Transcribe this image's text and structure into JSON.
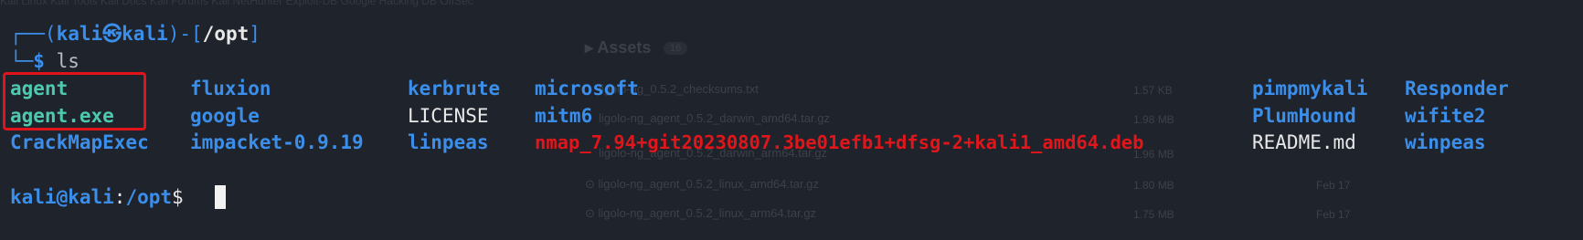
{
  "background": {
    "bookmarks": "Kali Linux   Kali Tools   Kali Docs   Kali Forums   Kali NetHunter   Exploit-DB   Google Hacking DB   OffSec",
    "assets_heading": "Assets",
    "assets_count": "16",
    "files": [
      {
        "name": "ligolo-ng_0.5.2_checksums.txt",
        "size": "1.57 KB"
      },
      {
        "name": "ligolo-ng_agent_0.5.2_darwin_amd64.tar.gz",
        "size": "1.98 MB"
      },
      {
        "name": "ligolo-ng_agent_0.5.2_darwin_arm64.tar.gz",
        "size": "1.96 MB"
      },
      {
        "name": "ligolo-ng_agent_0.5.2_linux_amd64.tar.gz",
        "size": "1.80 MB"
      },
      {
        "name": "ligolo-ng_agent_0.5.2_linux_arm64.tar.gz",
        "size": "1.75 MB"
      }
    ],
    "dates": [
      "Feb 17",
      "Feb 17"
    ]
  },
  "prompt": {
    "top_prefix": "┌──(",
    "user": "kali",
    "at_symbol": "㉿",
    "host": "kali",
    "mid": ")-[",
    "cwd": "/opt",
    "close": "]",
    "bottom_prefix": "└─",
    "dollar": "$",
    "command": " ls"
  },
  "listing": {
    "col1": [
      "agent",
      "agent.exe",
      "CrackMapExec"
    ],
    "col2": [
      "fluxion",
      "google",
      "impacket-0.9.19"
    ],
    "col3": [
      "kerbrute",
      "LICENSE",
      "linpeas"
    ],
    "col4": [
      "microsoft",
      "mitm6",
      "nmap_7.94+git20230807.3be01efb1+dfsg-2+kali1_amd64.deb"
    ],
    "col5": [
      "pimpmykali",
      "PlumHound",
      "README.md"
    ],
    "col6": [
      "Responder",
      "wifite2",
      "winpeas"
    ]
  },
  "second_prompt": {
    "user_host": "kali@kali",
    "colon": ":",
    "cwd": "/opt",
    "dollar": "$ "
  },
  "colors": {
    "background": "#1f232b",
    "directory": "#3b8eea",
    "executable": "#4ec9b0",
    "archive": "#e0161a",
    "file": "#e8e8e8",
    "highlight": "#e0141a"
  }
}
